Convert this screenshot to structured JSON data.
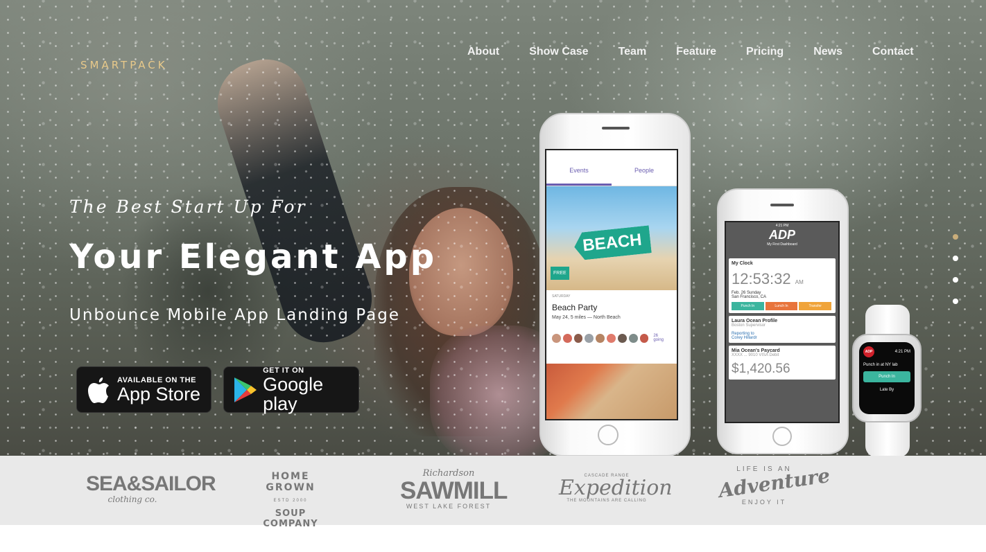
{
  "brand": {
    "logo": "SMARTPACK"
  },
  "nav": {
    "items": [
      "About",
      "Show Case",
      "Team",
      "Feature",
      "Pricing",
      "News",
      "Contact"
    ]
  },
  "hero": {
    "tagline": "The Best Start Up For",
    "headline": "Your Elegant App",
    "subhead": "Unbounce Mobile App Landing Page"
  },
  "stores": {
    "appstore": {
      "small": "AVAILABLE ON THE",
      "big": "App Store",
      "icon": "apple-icon"
    },
    "googleplay": {
      "small": "GET IT ON",
      "big": "Google play",
      "icon": "google-play-icon"
    }
  },
  "phone_events": {
    "tabs": [
      "Events",
      "People"
    ],
    "sign": "BEACH",
    "badge": "FREE",
    "meta": "SATURDAY",
    "title": "Beach Party",
    "sub": "May 24, 5 miles — North Beach",
    "going": "26 going"
  },
  "phone_adp": {
    "time": "4:21 PM",
    "logo": "ADP",
    "dashboard": "My First Dashboard",
    "clock_card": {
      "title": "My Clock",
      "time": "12:53:32",
      "ampm": "AM",
      "date": "Feb. 26 Sunday",
      "place": "San Francisco, CA",
      "buttons": [
        "Punch In",
        "Lunch In",
        "Transfer"
      ]
    },
    "profile_card": {
      "title": "Laura Ocean Profile",
      "role": "Boston Supervisor",
      "reporting": "Reporting to",
      "manager": "Corey Hillardr"
    },
    "pay_card": {
      "title": "Mia Ocean's Paycard",
      "sub": "XXXX ... 9010 VISA Debit",
      "amount": "$1,420.56"
    }
  },
  "watch": {
    "time": "4:21 PM",
    "badge": "ADP",
    "message": "Punch in at NY lab",
    "button": "Punch In",
    "late": "Late By"
  },
  "slider": {
    "count": 4,
    "active": 0
  },
  "clients": {
    "sea": {
      "main": "SEA&SAILOR",
      "sub": "clothing co."
    },
    "homegrown": {
      "top": "HOME GROWN",
      "mid": "ESTD  2000",
      "bottom": "SOUP COMPANY"
    },
    "sawmill": {
      "top": "Richardson",
      "main": "SAWMILL",
      "bottom": "WEST LAKE FOREST"
    },
    "expedition": {
      "top": "CASCADE RANGE",
      "main": "Expedition",
      "bottom": "THE MOUNTAINS ARE CALLING"
    },
    "adventure": {
      "top": "LIFE IS AN",
      "main": "Adventure",
      "bottom": "ENJOY IT"
    }
  },
  "colors": {
    "accent_gold": "#c9ad7a",
    "logo_gold": "#e8c98a",
    "strip_bg": "#e9e9e9",
    "teal": "#1fa68c"
  }
}
